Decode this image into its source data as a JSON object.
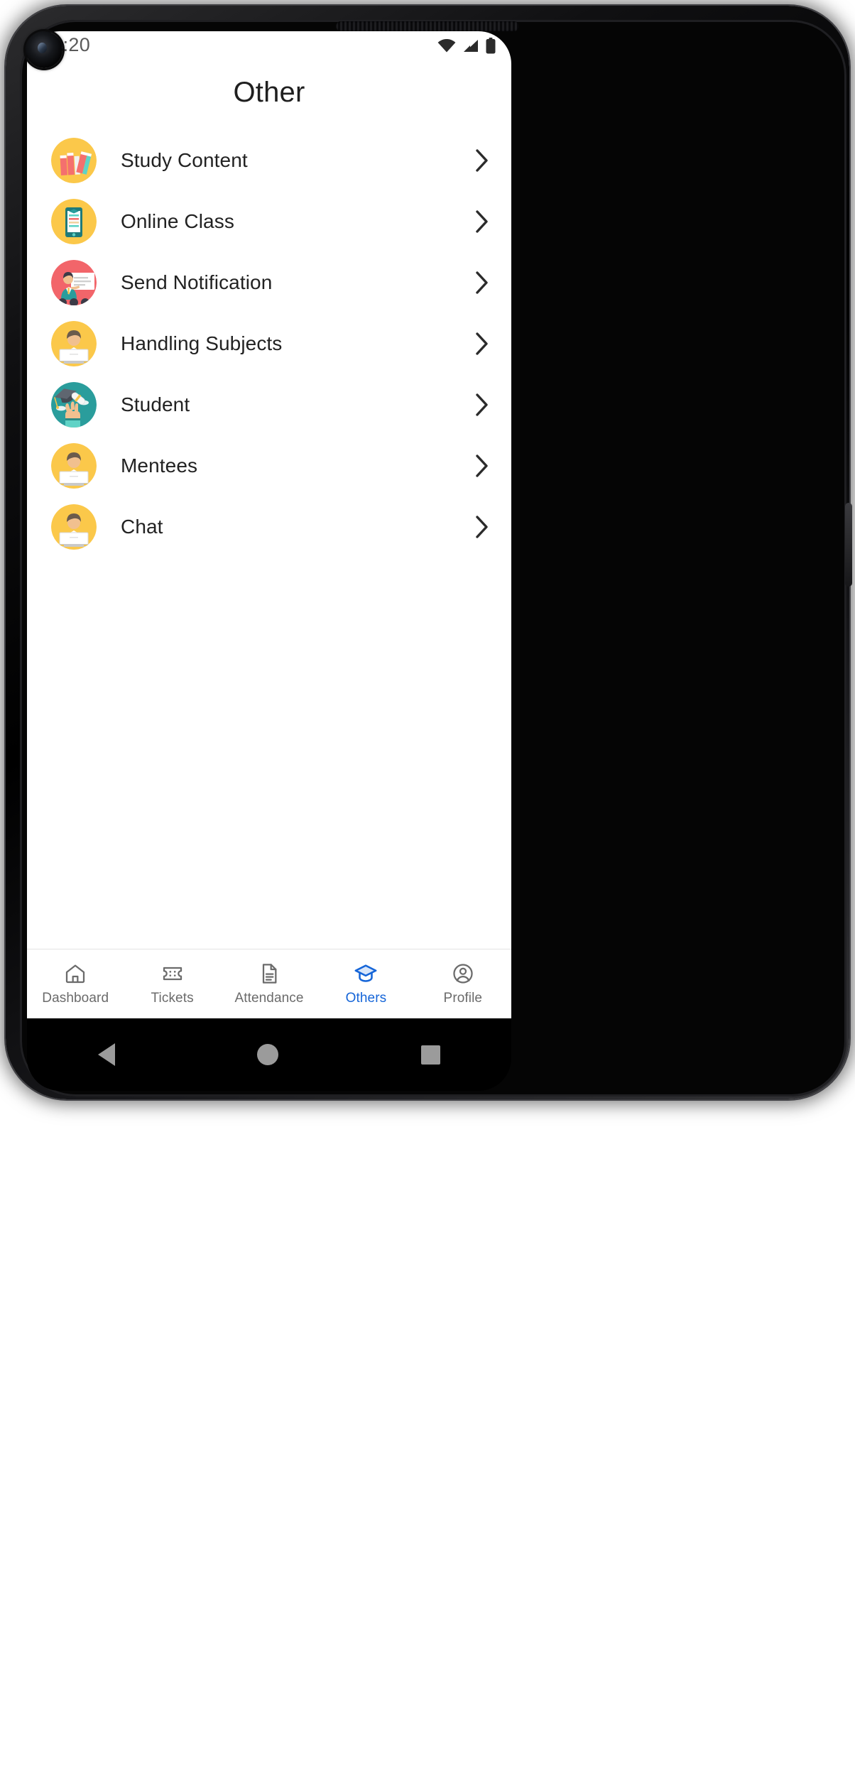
{
  "device": {
    "statusbar": {
      "time": "10:20",
      "icons": [
        "wifi-icon",
        "cellular-signal-icon",
        "battery-icon"
      ]
    },
    "navigation_bar": {
      "back": "back-triangle-icon",
      "home": "home-circle-icon",
      "recents": "recents-square-icon"
    }
  },
  "screen": {
    "title": "Other",
    "list": [
      {
        "label": "Study Content",
        "icon": "books-icon",
        "chevron": "chevron-right-icon"
      },
      {
        "label": "Online Class",
        "icon": "mobile-learning-icon",
        "chevron": "chevron-right-icon"
      },
      {
        "label": "Send Notification",
        "icon": "presentation-icon",
        "chevron": "chevron-right-icon"
      },
      {
        "label": "Handling Subjects",
        "icon": "person-laptop-icon",
        "chevron": "chevron-right-icon"
      },
      {
        "label": "Student",
        "icon": "graduation-icon",
        "chevron": "chevron-right-icon"
      },
      {
        "label": "Mentees",
        "icon": "person-laptop-icon",
        "chevron": "chevron-right-icon"
      },
      {
        "label": "Chat",
        "icon": "person-laptop-icon",
        "chevron": "chevron-right-icon"
      }
    ],
    "tabs": [
      {
        "label": "Dashboard",
        "icon": "home-icon",
        "active": false
      },
      {
        "label": "Tickets",
        "icon": "ticket-icon",
        "active": false
      },
      {
        "label": "Attendance",
        "icon": "document-icon",
        "active": false
      },
      {
        "label": "Others",
        "icon": "graduation-cap-icon",
        "active": true
      },
      {
        "label": "Profile",
        "icon": "account-circle-icon",
        "active": false
      }
    ]
  },
  "colors": {
    "accent": "#1565d8",
    "tab_inactive": "#6b6b6b",
    "avatar_yellow": "#fbc84a",
    "avatar_teal": "#2a9d9c",
    "avatar_coral": "#f2656a",
    "book_pink": "#f4706e",
    "book_teal": "#5fd3c6",
    "text_primary": "#222222",
    "divider": "#e3e3e3"
  }
}
